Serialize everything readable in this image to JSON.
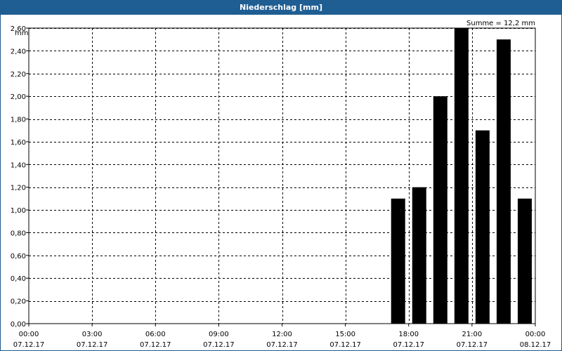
{
  "chart_data": {
    "type": "bar",
    "title": "Niederschlag [mm]",
    "ylabel": "mm",
    "annotation": "Summe = 12,2 mm",
    "ylim": [
      0,
      2.6
    ],
    "y_step": 0.2,
    "xlim_hours": [
      0,
      24
    ],
    "grid": true,
    "x_ticks": [
      {
        "time": "00:00",
        "date": "07.12.17"
      },
      {
        "time": "03:00",
        "date": "07.12.17"
      },
      {
        "time": "06:00",
        "date": "07.12.17"
      },
      {
        "time": "09:00",
        "date": "07.12.17"
      },
      {
        "time": "12:00",
        "date": "07.12.17"
      },
      {
        "time": "15:00",
        "date": "07.12.17"
      },
      {
        "time": "18:00",
        "date": "07.12.17"
      },
      {
        "time": "21:00",
        "date": "07.12.17"
      },
      {
        "time": "00:00",
        "date": "08.12.17"
      }
    ],
    "y_ticks": [
      "0,00",
      "0,20",
      "0,40",
      "0,60",
      "0,80",
      "1,00",
      "1,20",
      "1,40",
      "1,60",
      "1,80",
      "2,00",
      "2,20",
      "2,40",
      "2,60"
    ],
    "bars": [
      {
        "hour": 17.5,
        "value": 1.1
      },
      {
        "hour": 18.5,
        "value": 1.2
      },
      {
        "hour": 19.5,
        "value": 2.0
      },
      {
        "hour": 20.5,
        "value": 2.6
      },
      {
        "hour": 21.5,
        "value": 1.7
      },
      {
        "hour": 22.5,
        "value": 2.5
      },
      {
        "hour": 23.5,
        "value": 1.1
      }
    ],
    "bar_color": "#000000"
  }
}
